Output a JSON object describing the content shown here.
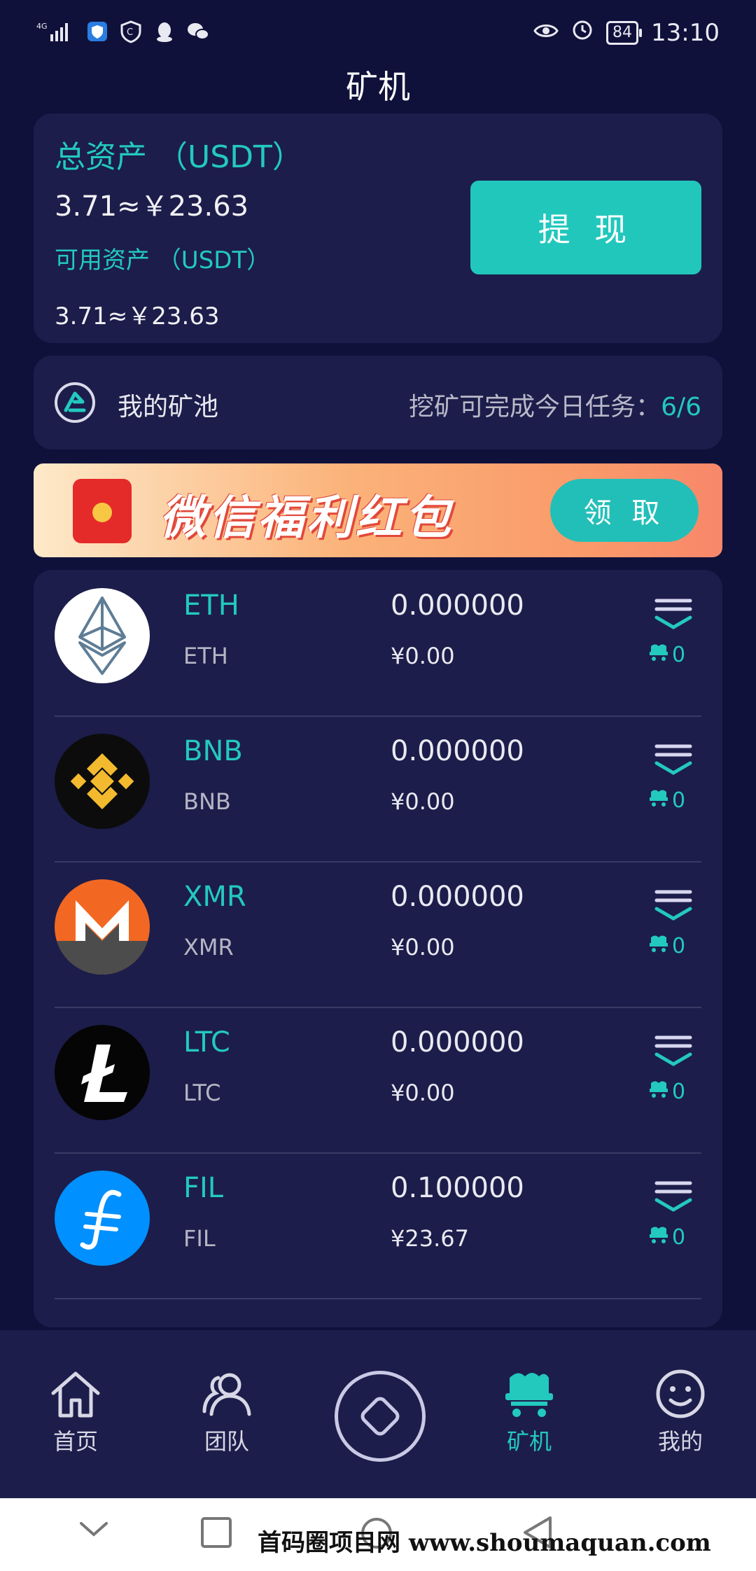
{
  "status_bar": {
    "network": "4G",
    "battery": "84",
    "time": "13:10"
  },
  "header": {
    "title": "矿机"
  },
  "assets": {
    "total_label": "总资产 （USDT）",
    "total_value": "3.71≈￥23.63",
    "available_label": "可用资产 （USDT）",
    "available_value": "3.71≈￥23.63",
    "withdraw_label": "提 现"
  },
  "pool": {
    "label": "我的矿池",
    "task_label": "挖矿可完成今日任务：",
    "task_value": "6/6"
  },
  "banner": {
    "text": "微信福利红包",
    "claim_label": "领 取"
  },
  "coins": [
    {
      "name": "ETH",
      "symbol": "ETH",
      "amount": "0.000000",
      "cny": "¥0.00",
      "machines": "0",
      "logo_icon": "eth-logo-icon"
    },
    {
      "name": "BNB",
      "symbol": "BNB",
      "amount": "0.000000",
      "cny": "¥0.00",
      "machines": "0",
      "logo_icon": "bnb-logo-icon"
    },
    {
      "name": "XMR",
      "symbol": "XMR",
      "amount": "0.000000",
      "cny": "¥0.00",
      "machines": "0",
      "logo_icon": "xmr-logo-icon"
    },
    {
      "name": "LTC",
      "symbol": "LTC",
      "amount": "0.000000",
      "cny": "¥0.00",
      "machines": "0",
      "logo_icon": "ltc-logo-icon"
    },
    {
      "name": "FIL",
      "symbol": "FIL",
      "amount": "0.100000",
      "cny": "¥23.67",
      "machines": "0",
      "logo_icon": "fil-logo-icon"
    }
  ],
  "nav": {
    "home": "首页",
    "team": "团队",
    "miner": "矿机",
    "mine": "我的"
  },
  "watermark": "首码圈项目网 www.shoumaquan.com",
  "colors": {
    "accent": "#23c9bd",
    "background": "#10113a",
    "card": "#1c1d4a"
  }
}
